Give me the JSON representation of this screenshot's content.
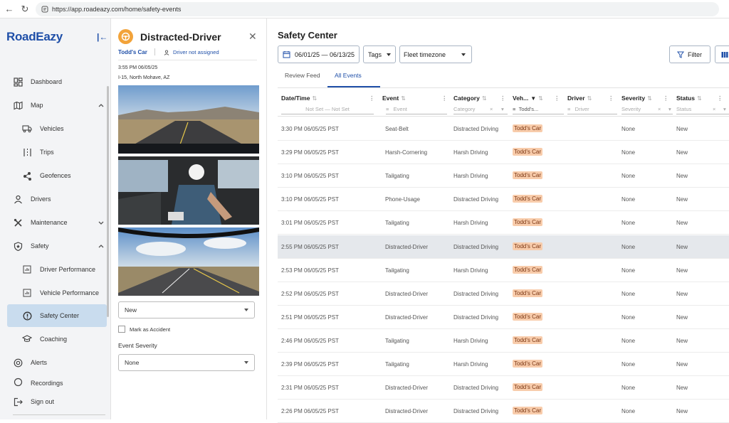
{
  "browser": {
    "url": "https://app.roadeazy.com/home/safety-events"
  },
  "sidebar": {
    "logo": "RoadEazy",
    "items": [
      {
        "label": "Dashboard"
      },
      {
        "label": "Map"
      },
      {
        "label": "Vehicles"
      },
      {
        "label": "Trips"
      },
      {
        "label": "Geofences"
      },
      {
        "label": "Drivers"
      },
      {
        "label": "Maintenance"
      },
      {
        "label": "Safety"
      },
      {
        "label": "Driver Performance"
      },
      {
        "label": "Vehicle Performance"
      },
      {
        "label": "Safety Center"
      },
      {
        "label": "Coaching"
      },
      {
        "label": "Alerts"
      },
      {
        "label": "Recordings"
      }
    ],
    "signout": "Sign out"
  },
  "detail": {
    "title": "Distracted-Driver",
    "vehicle": "Todd's Car",
    "driver": "Driver not assigned",
    "time": "3:55 PM 06/05/25",
    "location": "I-15, North Mohave, AZ",
    "status_value": "New",
    "mark_accident": "Mark as Accident",
    "severity_label": "Event Severity",
    "severity_value": "None"
  },
  "main": {
    "title": "Safety Center",
    "date_range": "06/01/25 — 06/13/25",
    "tags": "Tags",
    "timezone": "Fleet timezone",
    "filter": "Filter",
    "tabs": [
      "Review Feed",
      "All Events"
    ],
    "columns": [
      "Date/Time",
      "Event",
      "Category",
      "Veh...",
      "Driver",
      "Severity",
      "Status"
    ],
    "filters": {
      "date": "Not Set — Not Set",
      "event": "Event",
      "category": "Category",
      "vehicle": "Todd's...",
      "driver": "Driver",
      "severity": "Severity",
      "status": "Status"
    },
    "rows": [
      {
        "time": "3:30 PM 06/05/25 PST",
        "event": "Seat-Belt",
        "category": "Distracted Driving",
        "vehicle": "Todd's Car",
        "severity": "None",
        "status": "New"
      },
      {
        "time": "3:29 PM 06/05/25 PST",
        "event": "Harsh-Cornering",
        "category": "Harsh Driving",
        "vehicle": "Todd's Car",
        "severity": "None",
        "status": "New"
      },
      {
        "time": "3:10 PM 06/05/25 PST",
        "event": "Tailgating",
        "category": "Harsh Driving",
        "vehicle": "Todd's Car",
        "severity": "None",
        "status": "New"
      },
      {
        "time": "3:10 PM 06/05/25 PST",
        "event": "Phone-Usage",
        "category": "Distracted Driving",
        "vehicle": "Todd's Car",
        "severity": "None",
        "status": "New"
      },
      {
        "time": "3:01 PM 06/05/25 PST",
        "event": "Tailgating",
        "category": "Harsh Driving",
        "vehicle": "Todd's Car",
        "severity": "None",
        "status": "New"
      },
      {
        "time": "2:55 PM 06/05/25 PST",
        "event": "Distracted-Driver",
        "category": "Distracted Driving",
        "vehicle": "Todd's Car",
        "severity": "None",
        "status": "New"
      },
      {
        "time": "2:53 PM 06/05/25 PST",
        "event": "Tailgating",
        "category": "Harsh Driving",
        "vehicle": "Todd's Car",
        "severity": "None",
        "status": "New"
      },
      {
        "time": "2:52 PM 06/05/25 PST",
        "event": "Distracted-Driver",
        "category": "Distracted Driving",
        "vehicle": "Todd's Car",
        "severity": "None",
        "status": "New"
      },
      {
        "time": "2:51 PM 06/05/25 PST",
        "event": "Distracted-Driver",
        "category": "Distracted Driving",
        "vehicle": "Todd's Car",
        "severity": "None",
        "status": "New"
      },
      {
        "time": "2:46 PM 06/05/25 PST",
        "event": "Tailgating",
        "category": "Harsh Driving",
        "vehicle": "Todd's Car",
        "severity": "None",
        "status": "New"
      },
      {
        "time": "2:39 PM 06/05/25 PST",
        "event": "Tailgating",
        "category": "Harsh Driving",
        "vehicle": "Todd's Car",
        "severity": "None",
        "status": "New"
      },
      {
        "time": "2:31 PM 06/05/25 PST",
        "event": "Distracted-Driver",
        "category": "Distracted Driving",
        "vehicle": "Todd's Car",
        "severity": "None",
        "status": "New"
      },
      {
        "time": "2:26 PM 06/05/25 PST",
        "event": "Distracted-Driver",
        "category": "Distracted Driving",
        "vehicle": "Todd's Car",
        "severity": "None",
        "status": "New"
      }
    ],
    "selected_row": 5
  },
  "colors": {
    "brand": "#1f4fa8",
    "active_nav": "#c9dcee",
    "vehicle_chip": "#f8ccab",
    "selected_row": "#e5e8ec",
    "event_icon": "#f2a33a"
  }
}
